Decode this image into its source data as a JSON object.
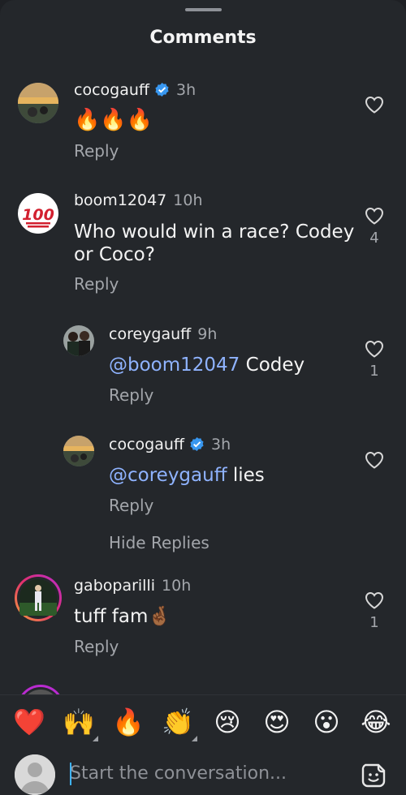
{
  "title": "Comments",
  "comments": [
    {
      "username": "cocogauff",
      "verified": true,
      "time": "3h",
      "text": "🔥🔥🔥",
      "reply": "Reply",
      "likes": ""
    },
    {
      "username": "boom12047",
      "verified": false,
      "time": "10h",
      "text_line1": "Who would win a race? Codey",
      "text_line2": "or Coco?",
      "reply": "Reply",
      "likes": "4"
    },
    {
      "username": "coreygauff",
      "verified": false,
      "time": "9h",
      "mention": "@boom12047",
      "text": " Codey",
      "reply": "Reply",
      "likes": "1"
    },
    {
      "username": "cocogauff",
      "verified": true,
      "time": "3h",
      "mention": "@coreygauff",
      "text": " lies",
      "reply": "Reply",
      "likes": ""
    },
    {
      "username": "gaboparilli",
      "verified": false,
      "time": "10h",
      "text": "tuff fam🤞🏾",
      "reply": "Reply",
      "likes": "1"
    }
  ],
  "hide_replies": "Hide Replies",
  "emoji_bar": [
    "❤️",
    "🙌",
    "🔥",
    "👏",
    "😢",
    "😍",
    "😮",
    "😂"
  ],
  "composer": {
    "placeholder": "Start the conversation..."
  },
  "colors": {
    "background": "#24272b",
    "text": "#f2f2f2",
    "secondary": "#a3a6ab",
    "mention": "#8fb3ff",
    "verified": "#3897f0"
  }
}
